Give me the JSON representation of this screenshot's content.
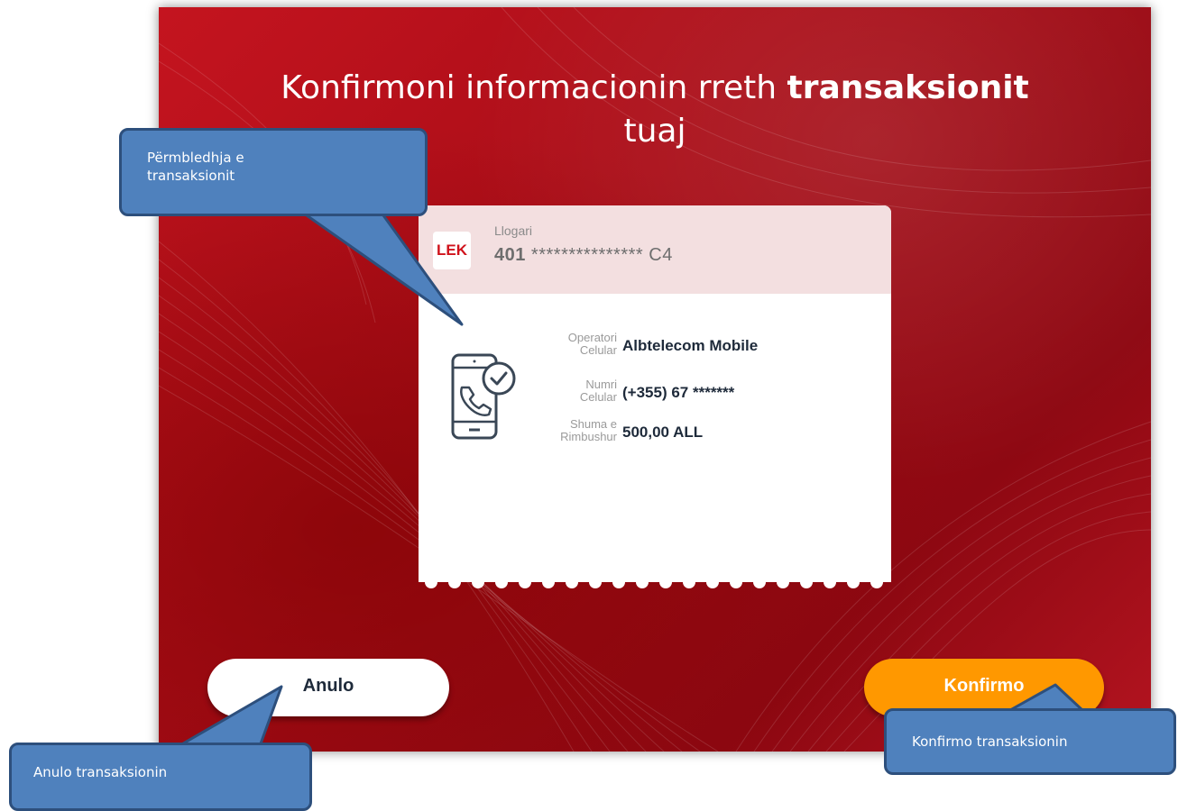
{
  "screen": {
    "title_regular": "Konfirmoni informacionin rreth",
    "title_bold": "transaksionit",
    "title_line2": "tuaj"
  },
  "account": {
    "currency_badge": "LEK",
    "label": "Llogari",
    "number_prefix": "401",
    "number_mask": " *************** ",
    "number_suffix": "C4"
  },
  "details": [
    {
      "label_line1": "Operatori",
      "label_line2": "Celular",
      "value": "Albtelecom Mobile"
    },
    {
      "label_line1": "Numri",
      "label_line2": "Celular",
      "value": "(+355) 67 *******"
    },
    {
      "label_line1": "Shuma e",
      "label_line2": "Rimbushur",
      "value": "500,00 ALL"
    }
  ],
  "buttons": {
    "cancel_label": "Anulo",
    "confirm_label": "Konfirmo"
  },
  "callouts": {
    "summary": "Përmbledhja e transaksionit",
    "cancel": "Anulo transaksionin",
    "confirm": "Konfirmo transaksionin"
  },
  "colors": {
    "brand_red": "#c4141f",
    "confirm_orange": "#ff9800",
    "callout_blue": "#4f81bd"
  },
  "icons": {
    "phone_check": "phone-check-icon"
  }
}
